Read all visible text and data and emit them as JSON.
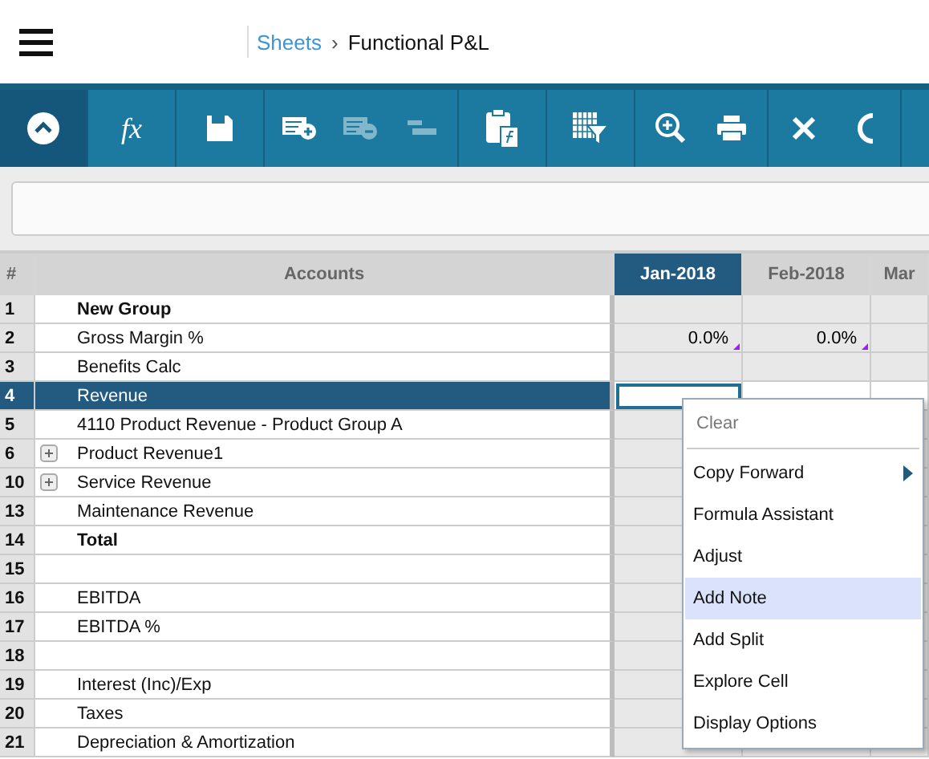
{
  "breadcrumb": {
    "parent": "Sheets",
    "separator": "›",
    "current": "Functional P&L"
  },
  "toolbar": {
    "groups": [
      [
        {
          "disabled": false
        }
      ],
      [
        {
          "disabled": false,
          "label": "fx"
        }
      ],
      [
        {
          "disabled": false
        }
      ],
      [
        {
          "disabled": false
        },
        {
          "disabled": true
        },
        {
          "disabled": true
        }
      ],
      [
        {
          "disabled": false
        }
      ],
      [
        {
          "disabled": false
        }
      ],
      [
        {
          "disabled": false
        },
        {
          "disabled": false
        }
      ],
      [
        {
          "disabled": false
        },
        {
          "disabled": false
        }
      ]
    ]
  },
  "grid": {
    "columns": [
      {
        "label": "#"
      },
      {
        "label": "Accounts"
      },
      {
        "label": "Jan-2018",
        "selected": true
      },
      {
        "label": "Feb-2018",
        "selected": false
      },
      {
        "label": "Mar",
        "selected": false
      }
    ],
    "rows": [
      {
        "bold": true,
        "expandable": false,
        "selected": false,
        "cells": [
          {
            "value": "1"
          },
          {
            "value": "New Group"
          },
          {},
          {},
          {}
        ]
      },
      {
        "bold": false,
        "expandable": false,
        "selected": false,
        "cells": [
          {
            "value": "2"
          },
          {
            "value": "Gross Margin %"
          },
          {
            "value": "0.0%",
            "note": true
          },
          {
            "value": "0.0%",
            "note": true
          },
          {}
        ]
      },
      {
        "bold": false,
        "expandable": false,
        "selected": false,
        "cells": [
          {
            "value": "3"
          },
          {
            "value": "Benefits Calc"
          },
          {},
          {},
          {}
        ]
      },
      {
        "bold": false,
        "expandable": false,
        "selected": true,
        "cells": [
          {
            "value": "4"
          },
          {
            "value": "Revenue"
          },
          {
            "active": true
          },
          {},
          {}
        ]
      },
      {
        "bold": false,
        "expandable": false,
        "selected": false,
        "cells": [
          {
            "value": "5"
          },
          {
            "value": "4110 Product Revenue - Product Group A"
          },
          {},
          {},
          {}
        ]
      },
      {
        "bold": false,
        "expandable": true,
        "selected": false,
        "cells": [
          {
            "value": "6"
          },
          {
            "value": "Product Revenue1"
          },
          {},
          {},
          {}
        ]
      },
      {
        "bold": false,
        "expandable": true,
        "selected": false,
        "cells": [
          {
            "value": "10"
          },
          {
            "value": "Service Revenue"
          },
          {},
          {},
          {}
        ]
      },
      {
        "bold": false,
        "expandable": false,
        "selected": false,
        "cells": [
          {
            "value": "13"
          },
          {
            "value": "Maintenance Revenue"
          },
          {},
          {},
          {}
        ]
      },
      {
        "bold": true,
        "expandable": false,
        "selected": false,
        "cells": [
          {
            "value": "14"
          },
          {
            "value": "Total"
          },
          {},
          {},
          {}
        ]
      },
      {
        "bold": false,
        "expandable": false,
        "selected": false,
        "cells": [
          {
            "value": "15"
          },
          {},
          {},
          {},
          {}
        ]
      },
      {
        "bold": false,
        "expandable": false,
        "selected": false,
        "cells": [
          {
            "value": "16"
          },
          {
            "value": "EBITDA"
          },
          {},
          {},
          {}
        ]
      },
      {
        "bold": false,
        "expandable": false,
        "selected": false,
        "cells": [
          {
            "value": "17"
          },
          {
            "value": "EBITDA %"
          },
          {},
          {},
          {}
        ]
      },
      {
        "bold": false,
        "expandable": false,
        "selected": false,
        "cells": [
          {
            "value": "18"
          },
          {},
          {},
          {},
          {}
        ]
      },
      {
        "bold": false,
        "expandable": false,
        "selected": false,
        "cells": [
          {
            "value": "19"
          },
          {
            "value": "Interest (Inc)/Exp"
          },
          {},
          {},
          {}
        ]
      },
      {
        "bold": false,
        "expandable": false,
        "selected": false,
        "cells": [
          {
            "value": "20"
          },
          {
            "value": "Taxes"
          },
          {},
          {},
          {}
        ]
      },
      {
        "bold": false,
        "expandable": false,
        "selected": false,
        "cells": [
          {
            "value": "21"
          },
          {
            "value": "Depreciation & Amortization"
          },
          {},
          {},
          {}
        ]
      }
    ]
  },
  "context_menu": [
    {
      "label": "Clear",
      "disabled": true,
      "selected": false,
      "submenu": false
    },
    {
      "label": "Copy Forward",
      "disabled": false,
      "selected": false,
      "submenu": true
    },
    {
      "label": "Formula Assistant",
      "disabled": false,
      "selected": false,
      "submenu": false
    },
    {
      "label": "Adjust",
      "disabled": false,
      "selected": false,
      "submenu": false
    },
    {
      "label": "Add Note",
      "disabled": false,
      "selected": true,
      "submenu": false
    },
    {
      "label": "Add Split",
      "disabled": false,
      "selected": false,
      "submenu": false
    },
    {
      "label": "Explore Cell",
      "disabled": false,
      "selected": false,
      "submenu": false
    },
    {
      "label": "Display Options",
      "disabled": false,
      "selected": false,
      "submenu": false
    }
  ]
}
